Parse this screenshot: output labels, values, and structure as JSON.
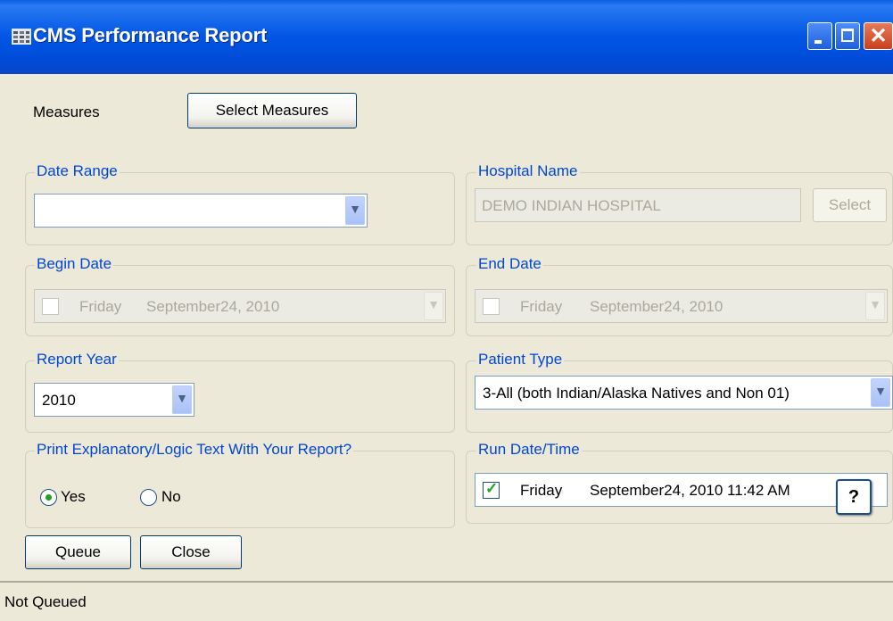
{
  "window": {
    "title": "CMS Performance Report"
  },
  "measures": {
    "label": "Measures",
    "button": "Select Measures"
  },
  "date_range": {
    "label": "Date Range",
    "value": ""
  },
  "hospital": {
    "label": "Hospital Name",
    "value": "DEMO INDIAN HOSPITAL",
    "button": "Select"
  },
  "begin_date": {
    "label": "Begin Date",
    "day": "Friday",
    "date": "September24, 2010",
    "checked": false
  },
  "end_date": {
    "label": "End Date",
    "day": "Friday",
    "date": "September24, 2010",
    "checked": false
  },
  "report_year": {
    "label": "Report Year",
    "value": "2010"
  },
  "patient_type": {
    "label": "Patient Type",
    "value": "3-All (both Indian/Alaska Natives and Non 01)"
  },
  "explanatory": {
    "label": "Print Explanatory/Logic Text With Your Report?",
    "yes": "Yes",
    "no": "No",
    "selected": "Yes"
  },
  "run_date": {
    "label": "Run Date/Time",
    "day": "Friday",
    "date": "September24, 2010  11:42 AM",
    "checked": true
  },
  "help_button": "?",
  "buttons": {
    "queue": "Queue",
    "close": "Close"
  },
  "status": {
    "text": "Not Queued"
  }
}
